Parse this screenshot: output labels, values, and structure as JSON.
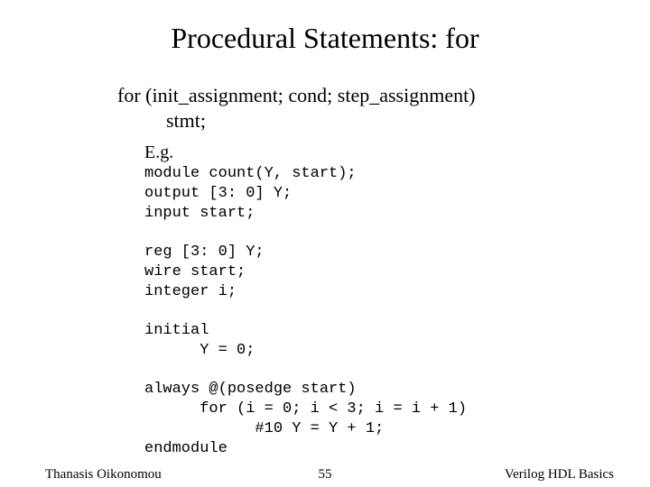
{
  "title": "Procedural Statements: for",
  "syntax_line1": "for (init_assignment; cond; step_assignment)",
  "syntax_line2": "stmt;",
  "eg_label": "E.g.",
  "code": "module count(Y, start);\noutput [3: 0] Y;\ninput start;\n\nreg [3: 0] Y;\nwire start;\ninteger i;\n\ninitial\n      Y = 0;\n\nalways @(posedge start)\n      for (i = 0; i < 3; i = i + 1)\n            #10 Y = Y + 1;\nendmodule",
  "footer": {
    "author": "Thanasis Oikonomou",
    "page": "55",
    "course": "Verilog HDL Basics"
  }
}
